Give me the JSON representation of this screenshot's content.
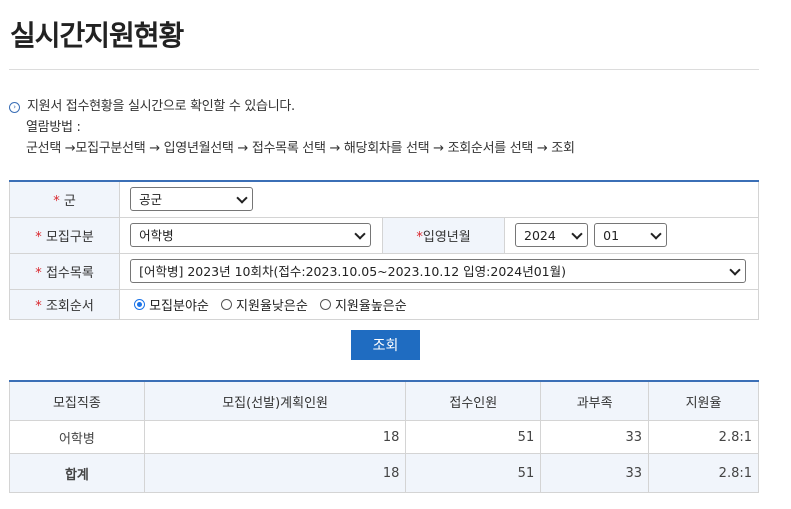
{
  "page": {
    "title": "실시간지원현황"
  },
  "guide": {
    "line1": "지원서 접수현황을 실시간으로 확인할 수 있습니다.",
    "line2": "열람방법 :",
    "line3": "군선택 →모집구분선택 → 입영년월선택 → 접수목록 선택 → 해당회차를 선택 → 조회순서를 선택 → 조회"
  },
  "form": {
    "required_mark": "*",
    "army_label": "군",
    "army_value": "공군",
    "recruit_type_label": "모집구분",
    "recruit_type_value": "어학병",
    "enlist_month_label": "입영년월",
    "enlist_year_value": "2024",
    "enlist_month_value": "01",
    "receipt_list_label": "접수목록",
    "receipt_list_value": "[어학병] 2023년 10회차(접수:2023.10.05~2023.10.12 입영:2024년01월)",
    "sort_label": "조회순서",
    "sort_options": [
      "모집분야순",
      "지원율낮은순",
      "지원율높은순"
    ],
    "sort_selected": 0
  },
  "query_button": "조회",
  "results": {
    "headers": [
      "모집직종",
      "모집(선발)계획인원",
      "접수인원",
      "과부족",
      "지원율"
    ],
    "rows": [
      [
        "어학병",
        "18",
        "51",
        "33",
        "2.8:1"
      ]
    ],
    "total": [
      "합계",
      "18",
      "51",
      "33",
      "2.8:1"
    ]
  },
  "colors": {
    "accent": "#3b6fb6",
    "button": "#1f6cc1",
    "required": "#d9262c",
    "header_bg": "#f1f5fb"
  }
}
